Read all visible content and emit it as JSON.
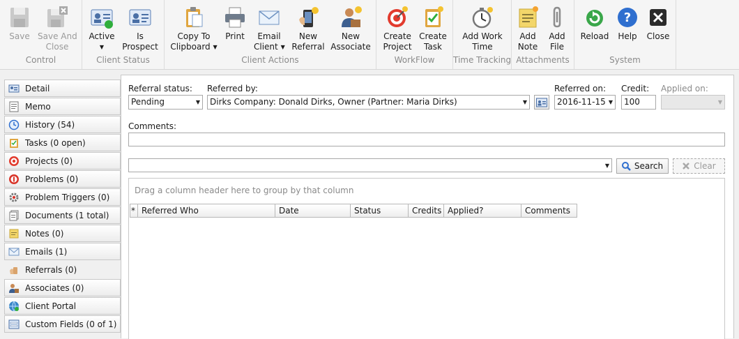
{
  "ribbon": {
    "groups": [
      {
        "label": "Control",
        "buttons": [
          {
            "label": "Save"
          },
          {
            "label": "Save And",
            "label2": "Close"
          }
        ]
      },
      {
        "label": "Client Status",
        "buttons": [
          {
            "label": "Active",
            "caret": "▼"
          },
          {
            "label": "Is",
            "label2": "Prospect"
          }
        ]
      },
      {
        "label": "Client Actions",
        "buttons": [
          {
            "label": "Copy To",
            "label2": "Clipboard",
            "caret": "▼"
          },
          {
            "label": "Print"
          },
          {
            "label": "Email",
            "label2": "Client",
            "caret": "▼"
          },
          {
            "label": "New",
            "label2": "Referral"
          },
          {
            "label": "New",
            "label2": "Associate"
          }
        ]
      },
      {
        "label": "WorkFlow",
        "buttons": [
          {
            "label": "Create",
            "label2": "Project"
          },
          {
            "label": "Create",
            "label2": "Task"
          }
        ]
      },
      {
        "label": "Time Tracking",
        "buttons": [
          {
            "label": "Add Work",
            "label2": "Time"
          }
        ]
      },
      {
        "label": "Attachments",
        "buttons": [
          {
            "label": "Add",
            "label2": "Note"
          },
          {
            "label": "Add",
            "label2": "File"
          }
        ]
      },
      {
        "label": "System",
        "buttons": [
          {
            "label": "Reload"
          },
          {
            "label": "Help"
          },
          {
            "label": "Close"
          }
        ]
      }
    ]
  },
  "nav": {
    "items": [
      {
        "label": "Detail",
        "icon": "detail-icon"
      },
      {
        "label": "Memo",
        "icon": "memo-icon"
      },
      {
        "label": "History (54)",
        "icon": "history-icon"
      },
      {
        "label": "Tasks (0 open)",
        "icon": "tasks-icon"
      },
      {
        "label": "Projects (0)",
        "icon": "projects-icon"
      },
      {
        "label": "Problems (0)",
        "icon": "problems-icon"
      },
      {
        "label": "Problem Triggers (0)",
        "icon": "problem-triggers-icon"
      },
      {
        "label": "Documents (1 total)",
        "icon": "documents-icon"
      },
      {
        "label": "Notes (0)",
        "icon": "notes-icon"
      },
      {
        "label": "Emails (1)",
        "icon": "emails-icon"
      },
      {
        "label": "Referrals (0)",
        "icon": "referrals-icon",
        "active": true
      },
      {
        "label": "Associates (0)",
        "icon": "associates-icon"
      },
      {
        "label": "Client Portal",
        "icon": "client-portal-icon"
      },
      {
        "label": "Custom Fields (0 of 1)",
        "icon": "custom-fields-icon"
      }
    ]
  },
  "form": {
    "referral_status_label": "Referral status:",
    "referral_status_value": "Pending",
    "referred_by_label": "Referred by:",
    "referred_by_value": "Dirks Company: Donald Dirks, Owner (Partner: Maria Dirks)",
    "referred_on_label": "Referred on:",
    "referred_on_value": "2016-11-15",
    "credit_label": "Credit:",
    "credit_value": "100",
    "applied_on_label": "Applied on:",
    "applied_on_value": "",
    "comments_label": "Comments:",
    "comments_value": "",
    "dropdown_arrow": "▼"
  },
  "search": {
    "value": "",
    "search_label": "Search",
    "clear_label": "Clear"
  },
  "grid": {
    "group_hint": "Drag a column header here to group by that column",
    "new_row_marker": "*",
    "columns": [
      "Referred Who",
      "Date",
      "Status",
      "Credits",
      "Applied?",
      "Comments"
    ]
  },
  "colors": {
    "accent": "#2f6fcf",
    "disabled_text": "#9a9a9a"
  }
}
